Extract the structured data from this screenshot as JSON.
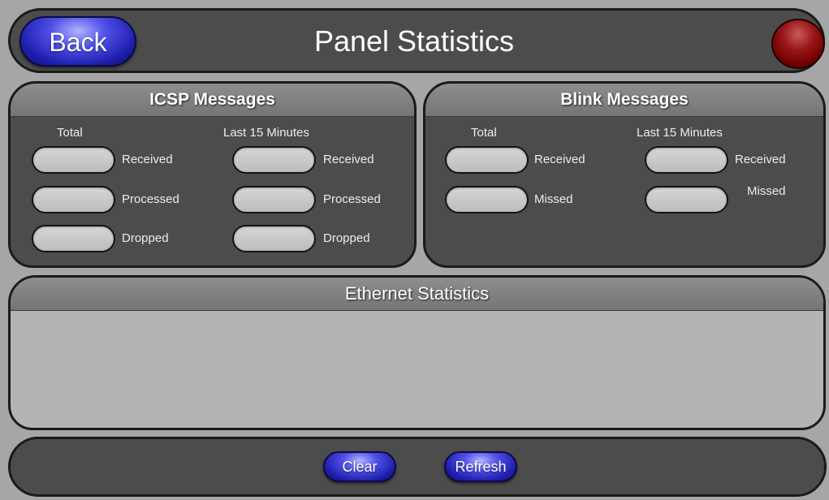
{
  "header": {
    "back_label": "Back",
    "title": "Panel Statistics",
    "status_light_color": "#8b0000"
  },
  "icsp": {
    "title": "ICSP Messages",
    "total_label": "Total",
    "last15_label": "Last 15 Minutes",
    "rows": [
      {
        "total_value": "",
        "total_label": "Received",
        "last15_value": "",
        "last15_label": "Received"
      },
      {
        "total_value": "",
        "total_label": "Processed",
        "last15_value": "",
        "last15_label": "Processed"
      },
      {
        "total_value": "",
        "total_label": "Dropped",
        "last15_value": "",
        "last15_label": "Dropped"
      }
    ]
  },
  "blink": {
    "title": "Blink Messages",
    "total_label": "Total",
    "last15_label": "Last 15 Minutes",
    "rows": [
      {
        "total_value": "",
        "total_label": "Received",
        "last15_value": "",
        "last15_label": "Received"
      },
      {
        "total_value": "",
        "total_label": "Missed",
        "last15_value": "",
        "last15_label": "Missed"
      }
    ]
  },
  "ethernet": {
    "title": "Ethernet Statistics",
    "content": ""
  },
  "footer": {
    "clear_label": "Clear",
    "refresh_label": "Refresh"
  },
  "colors": {
    "background": "#a6a6a6",
    "panel": "#4c4c4c",
    "button_blue": "#1f1fae",
    "field": "#c8c8c8"
  }
}
